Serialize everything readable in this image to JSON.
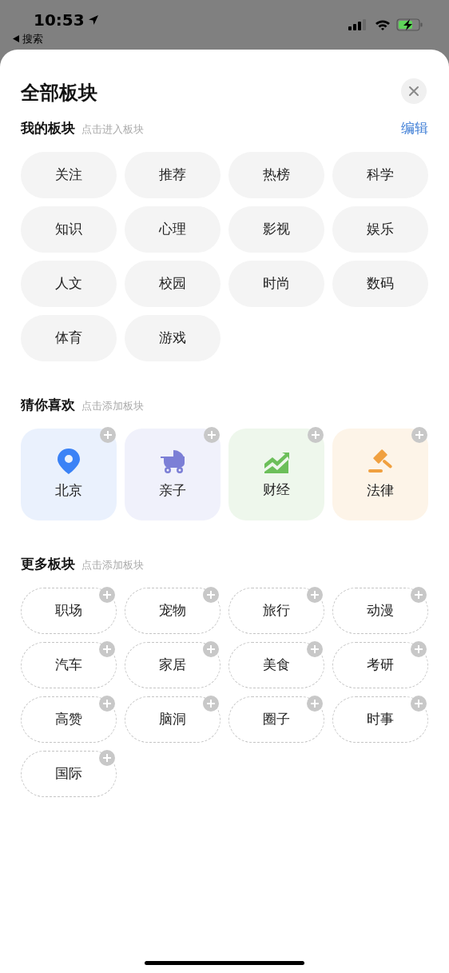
{
  "status_bar": {
    "time": "10:53",
    "back_label": "搜索"
  },
  "title": "全部板块",
  "my_sections": {
    "title": "我的板块",
    "hint": "点击进入板块",
    "action": "编辑",
    "items": [
      "关注",
      "推荐",
      "热榜",
      "科学",
      "知识",
      "心理",
      "影视",
      "娱乐",
      "人文",
      "校园",
      "时尚",
      "数码",
      "体育",
      "游戏"
    ]
  },
  "suggested": {
    "title": "猜你喜欢",
    "hint": "点击添加板块",
    "items": [
      {
        "label": "北京",
        "kind": "pin",
        "color": "#3b82f6"
      },
      {
        "label": "亲子",
        "kind": "stroller",
        "color": "#7c7fd6"
      },
      {
        "label": "财经",
        "kind": "chart",
        "color": "#6cbf5a"
      },
      {
        "label": "法律",
        "kind": "gavel",
        "color": "#f0a040"
      }
    ]
  },
  "more_sections": {
    "title": "更多板块",
    "hint": "点击添加板块",
    "items": [
      "职场",
      "宠物",
      "旅行",
      "动漫",
      "汽车",
      "家居",
      "美食",
      "考研",
      "高赞",
      "脑洞",
      "圈子",
      "时事",
      "国际"
    ]
  }
}
